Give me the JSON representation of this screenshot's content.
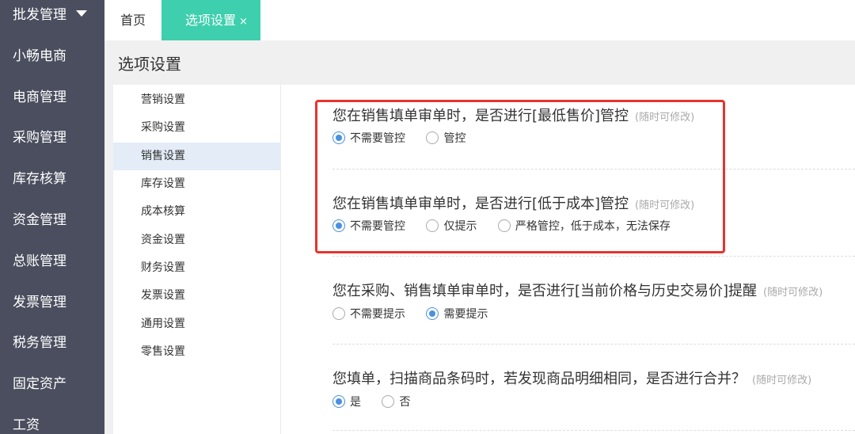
{
  "nav": {
    "top_label": "批发管理",
    "items": [
      "小畅电商",
      "电商管理",
      "采购管理",
      "库存核算",
      "资金管理",
      "总账管理",
      "发票管理",
      "税务管理",
      "固定资产",
      "工资"
    ]
  },
  "tabs": {
    "home": "首页",
    "active": "选项设置",
    "close": "×"
  },
  "page": {
    "title": "选项设置"
  },
  "subnav": {
    "items": [
      "营销设置",
      "采购设置",
      "销售设置",
      "库存设置",
      "成本核算",
      "资金设置",
      "财务设置",
      "发票设置",
      "通用设置",
      "零售设置"
    ],
    "active": "销售设置"
  },
  "hint": "(随时可修改)",
  "settings": [
    {
      "question": "您在销售填单审单时，是否进行[最低售价]管控",
      "options": [
        "不需要管控",
        "管控"
      ],
      "selected": "不需要管控"
    },
    {
      "question": "您在销售填单审单时，是否进行[低于成本]管控",
      "options": [
        "不需要管控",
        "仅提示",
        "严格管控，低于成本，无法保存"
      ],
      "selected": "不需要管控"
    },
    {
      "question": "您在采购、销售填单审单时，是否进行[当前价格与历史交易价]提醒",
      "options": [
        "不需要提示",
        "需要提示"
      ],
      "selected": "需要提示"
    },
    {
      "question": "您填单，扫描商品条码时，若发现商品明细相同，是否进行合并？",
      "options": [
        "是",
        "否"
      ],
      "selected": "是"
    }
  ],
  "colors": {
    "nav_bg": "#4a4e5e",
    "tab_active": "#3ecfae",
    "radio": "#4a90e2",
    "highlight": "#e8332f"
  }
}
